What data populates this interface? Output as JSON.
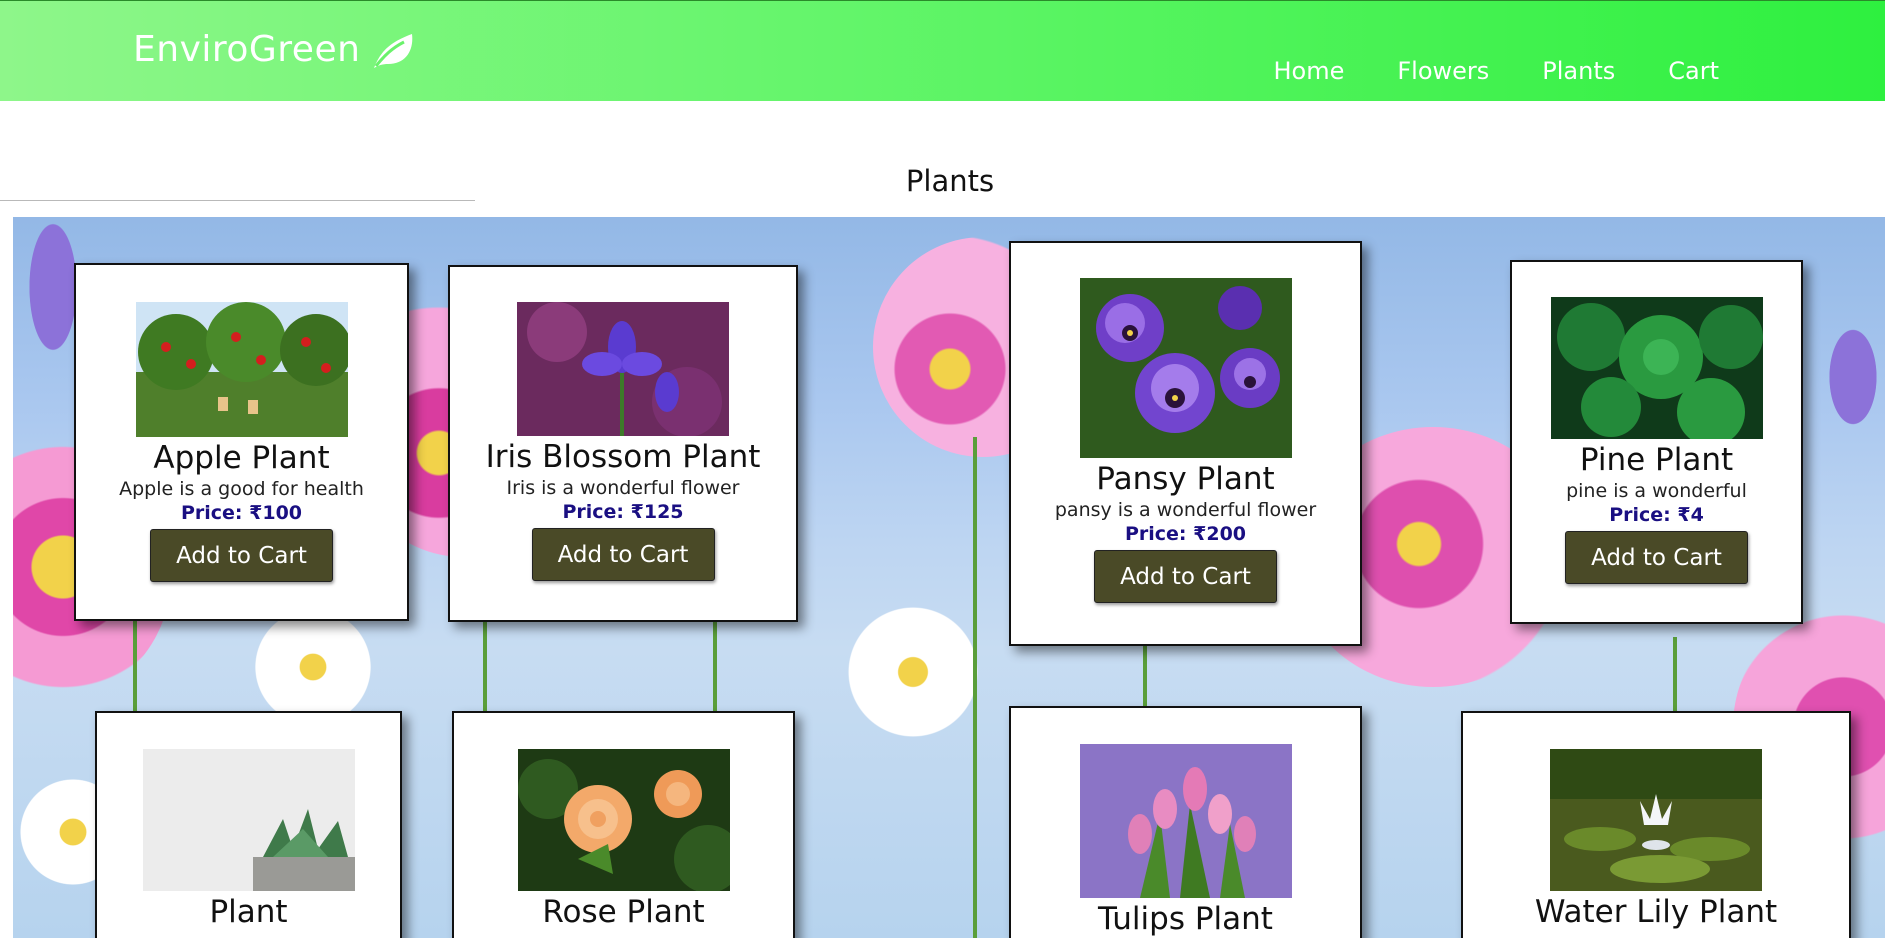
{
  "brand": {
    "name": "EnviroGreen",
    "icon": "leaf-icon"
  },
  "nav": [
    "Home",
    "Flowers",
    "Plants",
    "Cart"
  ],
  "section_title": "Plants",
  "products": [
    {
      "name": "Apple Plant",
      "desc": "Apple is a good for health",
      "price": "Price: ₹100",
      "button": "Add to Cart"
    },
    {
      "name": "Iris Blossom Plant",
      "desc": "Iris is a wonderful flower",
      "price": "Price: ₹125",
      "button": "Add to Cart"
    },
    {
      "name": "Pansy Plant",
      "desc": "pansy is a wonderful flower",
      "price": "Price: ₹200",
      "button": "Add to Cart"
    },
    {
      "name": "Pine Plant",
      "desc": "pine is a wonderful",
      "price": "Price: ₹4",
      "button": "Add to Cart"
    },
    {
      "name": "Plant"
    },
    {
      "name": "Rose Plant"
    },
    {
      "name": "Tulips Plant"
    },
    {
      "name": "Water Lily Plant"
    }
  ],
  "colors": {
    "header_start": "#8ef68a",
    "header_end": "#2ef03f",
    "button": "#4a4a27",
    "price": "#1a0f82"
  }
}
